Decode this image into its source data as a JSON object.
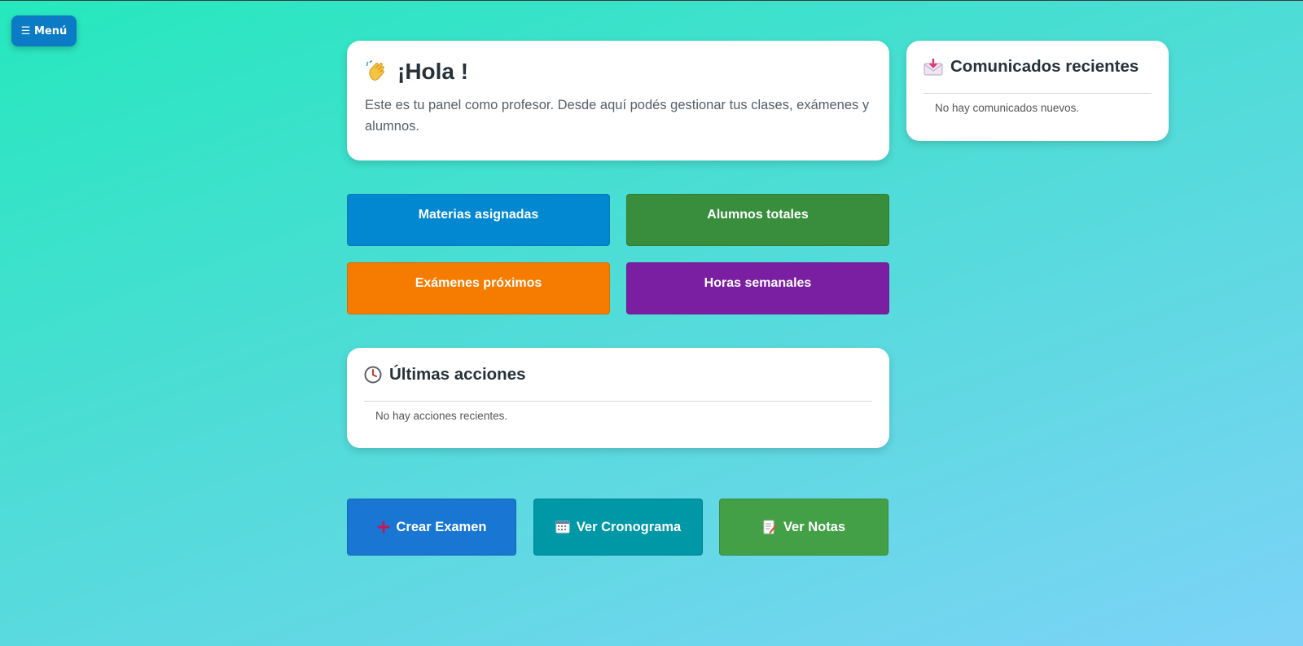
{
  "menu": {
    "label": "☰ Menú"
  },
  "welcome": {
    "icon": "waving-hand-icon",
    "title": "¡Hola !",
    "text": "Este es tu panel como profesor. Desde aquí podés gestionar tus clases, exámenes y alumnos."
  },
  "news": {
    "icon": "incoming-envelope-icon",
    "title": "Comunicados recientes",
    "empty": "No hay comunicados nuevos."
  },
  "stats": [
    {
      "label": "Materias asignadas",
      "color": "#0288d1"
    },
    {
      "label": "Alumnos totales",
      "color": "#388e3c"
    },
    {
      "label": "Exámenes próximos",
      "color": "#f57c00"
    },
    {
      "label": "Horas semanales",
      "color": "#7b1fa2"
    }
  ],
  "actions": {
    "icon": "clock-icon",
    "title": "Últimas acciones",
    "empty": "No hay acciones recientes."
  },
  "buttons": [
    {
      "label": "Crear Examen",
      "icon": "plus-icon",
      "color": "#1976d2"
    },
    {
      "label": "Ver Cronograma",
      "icon": "calendar-icon",
      "color": "#0097a7"
    },
    {
      "label": "Ver Notas",
      "icon": "memo-icon",
      "color": "#43a047"
    }
  ]
}
